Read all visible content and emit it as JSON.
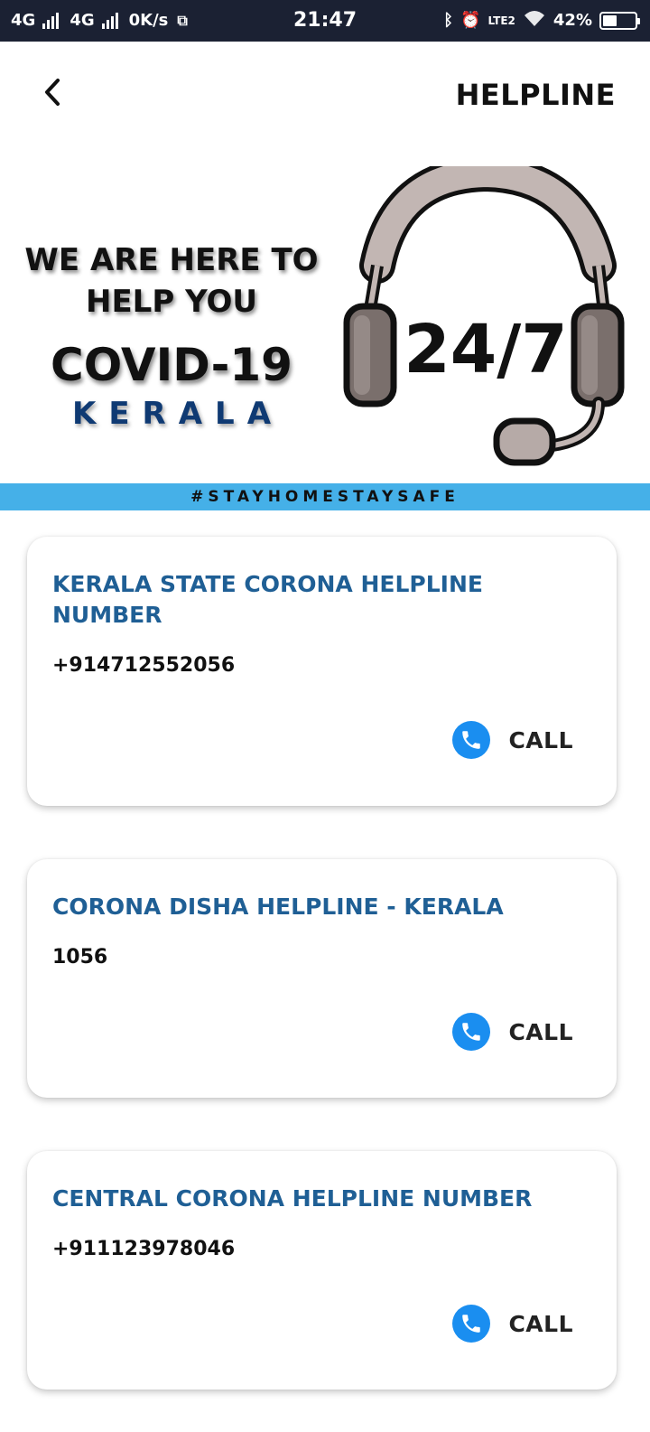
{
  "status_bar": {
    "left_text": [
      "4G",
      "4G",
      "0K/s"
    ],
    "time": "21:47",
    "network": "LTE2",
    "battery": "42%",
    "battery_level": 0.42
  },
  "header": {
    "title": "HELPLINE",
    "back_icon": "chevron-left-icon"
  },
  "banner": {
    "line1": "WE ARE HERE TO",
    "line2": "HELP YOU",
    "covid": "COVID-19",
    "region": "KERALA",
    "badge": "24/7",
    "badge_icon": "headset-icon"
  },
  "hashtag": "#STAYHOMESTAYSAFE",
  "colors": {
    "accent": "#1f5f95",
    "hashtag_bg": "#45b0e8",
    "call_icon": "#1a8ef0",
    "status_bar": "#1b2133"
  },
  "helplines": [
    {
      "title": "KERALA STATE CORONA HELPLINE NUMBER",
      "number": "+914712552056",
      "action": "CALL"
    },
    {
      "title": "CORONA DISHA HELPLINE - KERALA",
      "number": "1056",
      "action": "CALL"
    },
    {
      "title": "CENTRAL CORONA HELPLINE NUMBER",
      "number": "+911123978046",
      "action": "CALL"
    }
  ]
}
